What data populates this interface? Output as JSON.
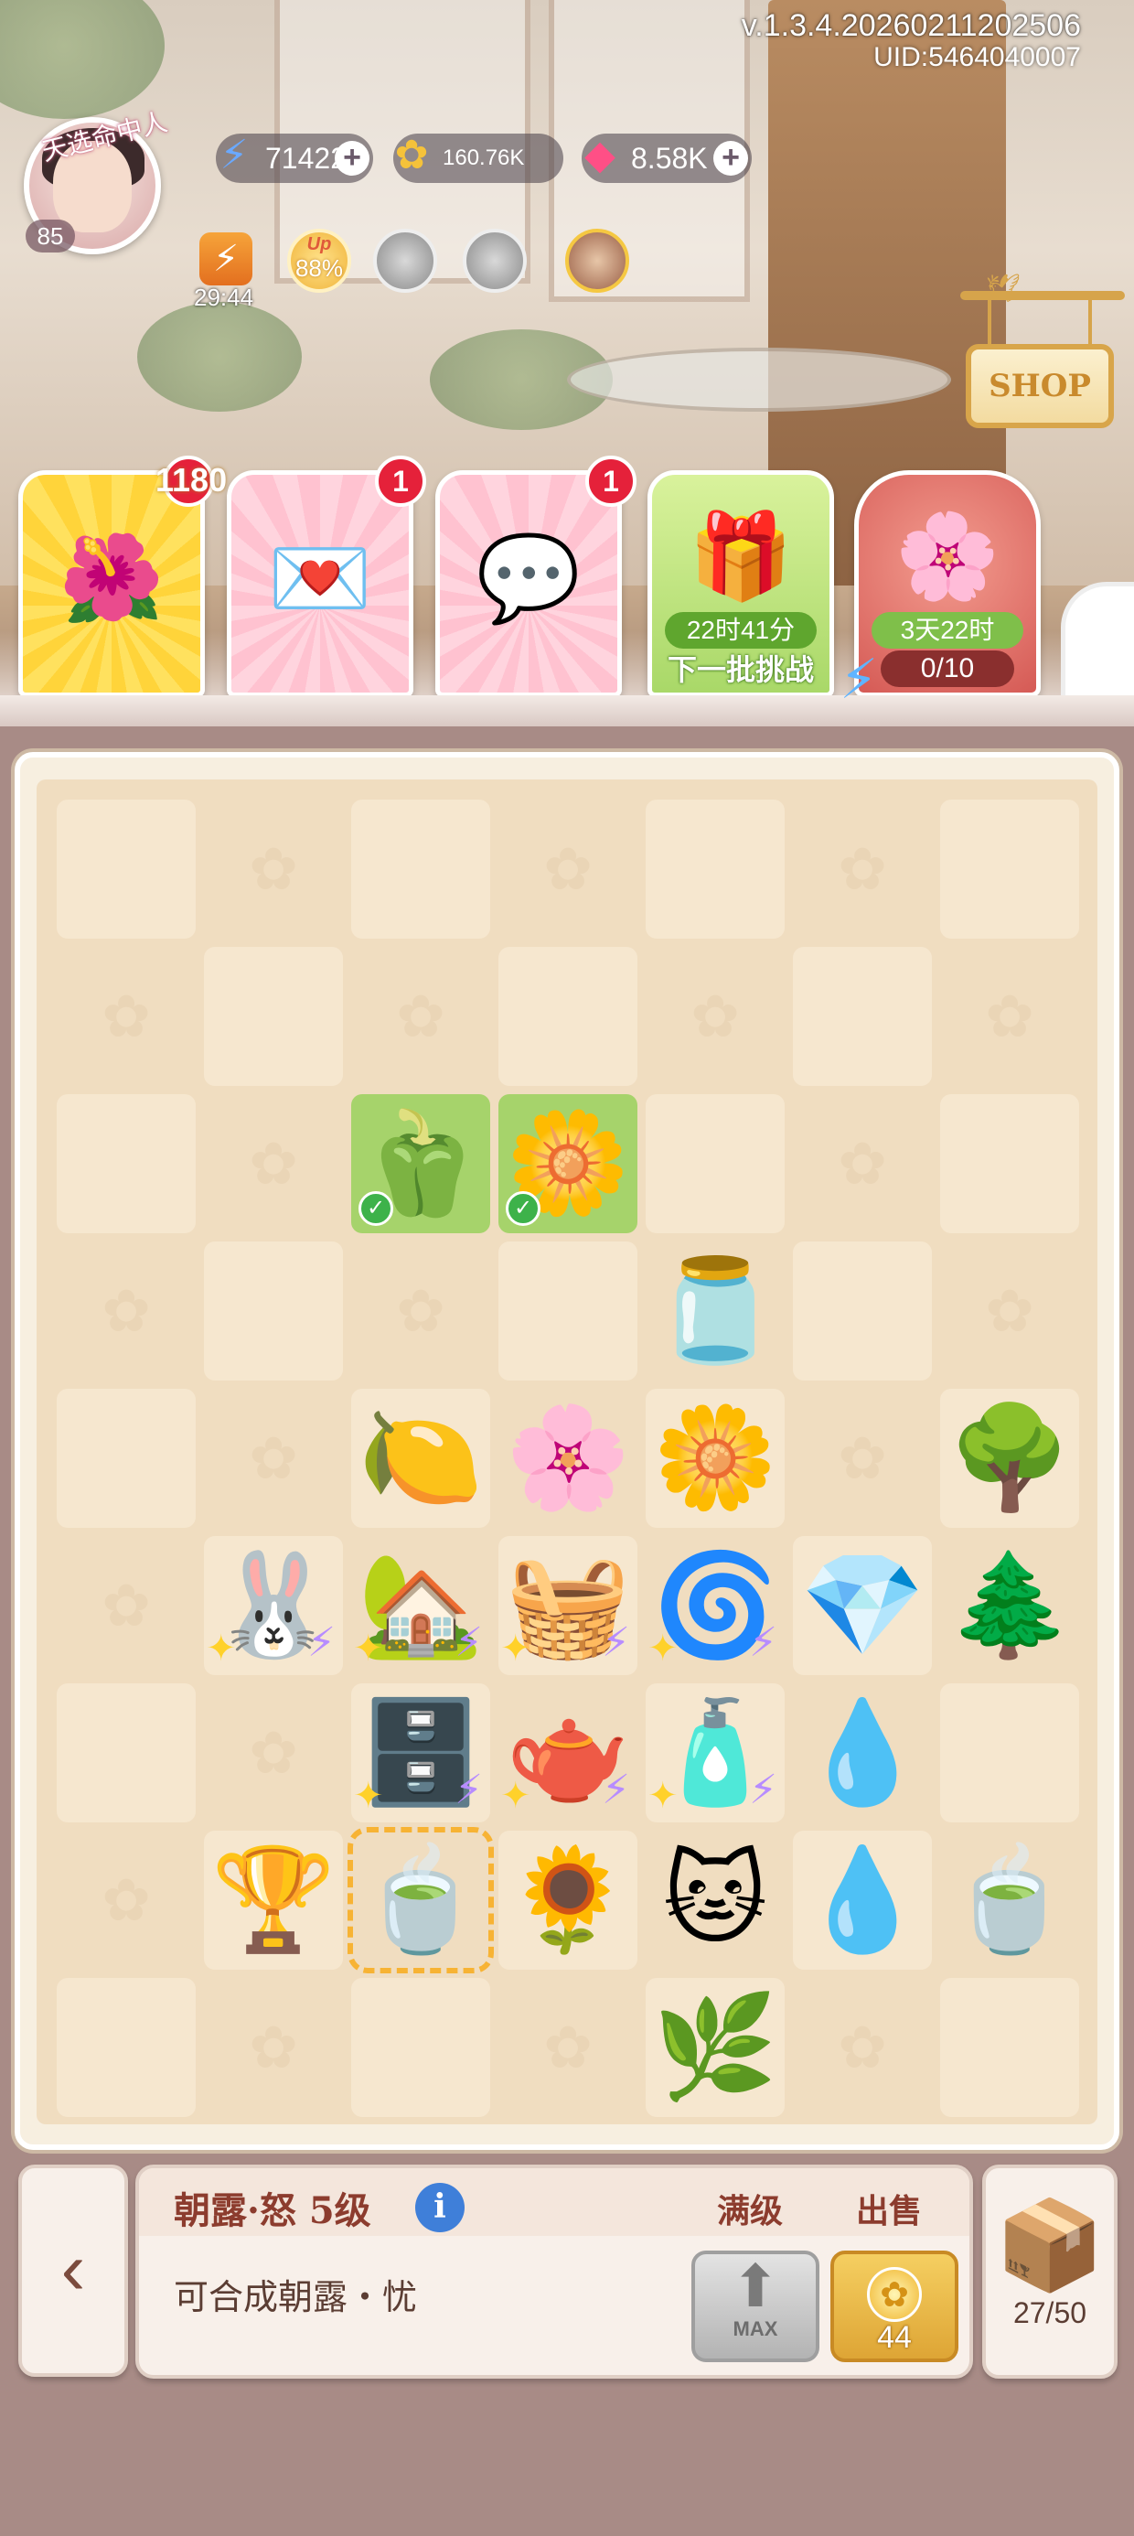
{
  "header": {
    "version": "v.1.3.4.20260211202506",
    "uid": "UID:5464040007",
    "avatar_title": "天选命中人",
    "level": "85"
  },
  "resources": [
    {
      "name": "energy",
      "icon": "lightning-icon",
      "value": "71422"
    },
    {
      "name": "coins",
      "icon": "clover-coin-icon",
      "value": "160.76K"
    },
    {
      "name": "gems",
      "icon": "gem-icon",
      "value": "8.58K"
    }
  ],
  "buffs": {
    "energy_timer": "29:44",
    "up_label": "Up",
    "up_value": "88%"
  },
  "shop": {
    "label": "SHOP"
  },
  "cards": [
    {
      "id": "card-bell-jar",
      "badge": "1180",
      "icon": "flower-bell-jar-icon"
    },
    {
      "id": "card-letter",
      "badge": "1",
      "icon": "love-letter-icon"
    },
    {
      "id": "card-chat",
      "badge": "1",
      "icon": "hashtag-chat-icon"
    },
    {
      "id": "card-gift",
      "timer": "22时41分",
      "subtitle": "下一批挑战",
      "icon": "gift-box-icon"
    },
    {
      "id": "card-event",
      "timer": "3天22时",
      "progress": "0/10",
      "icon": "peach-blossom-icon"
    }
  ],
  "board": {
    "columns": 7,
    "rows": 9,
    "items": [
      {
        "row": 2,
        "col": 2,
        "name": "pepper-creature",
        "glyph": "🫑",
        "selected": true
      },
      {
        "row": 2,
        "col": 3,
        "name": "osmanthus-branch",
        "glyph": "🌼",
        "selected": true
      },
      {
        "row": 3,
        "col": 4,
        "name": "vine-bell-jar",
        "glyph": "🫙"
      },
      {
        "row": 4,
        "col": 2,
        "name": "lemon",
        "glyph": "🍋"
      },
      {
        "row": 4,
        "col": 3,
        "name": "lily",
        "glyph": "🌸"
      },
      {
        "row": 4,
        "col": 4,
        "name": "magnolia",
        "glyph": "🌼"
      },
      {
        "row": 4,
        "col": 6,
        "name": "red-tree-bell-jar",
        "glyph": "🌳"
      },
      {
        "row": 5,
        "col": 1,
        "name": "bunny-dessert-stand",
        "glyph": "🐰",
        "sparkle": true
      },
      {
        "row": 5,
        "col": 2,
        "name": "greenhouse",
        "glyph": "🏡",
        "sparkle": true
      },
      {
        "row": 5,
        "col": 3,
        "name": "flower-cart",
        "glyph": "🧺",
        "sparkle": true
      },
      {
        "row": 5,
        "col": 4,
        "name": "galaxy-swirl",
        "glyph": "🌀",
        "sparkle": true
      },
      {
        "row": 5,
        "col": 5,
        "name": "red-crystal",
        "glyph": "💎"
      },
      {
        "row": 5,
        "col": 6,
        "name": "blue-tree-bell-jar",
        "glyph": "🌲"
      },
      {
        "row": 6,
        "col": 2,
        "name": "golden-cabinet",
        "glyph": "🗄️",
        "sparkle": true
      },
      {
        "row": 6,
        "col": 3,
        "name": "teapot",
        "glyph": "🫖",
        "sparkle": true
      },
      {
        "row": 6,
        "col": 4,
        "name": "perfume-bottle",
        "glyph": "🧴",
        "sparkle": true
      },
      {
        "row": 6,
        "col": 5,
        "name": "sad-water-drop",
        "glyph": "💧"
      },
      {
        "row": 7,
        "col": 1,
        "name": "golden-cup-tile",
        "glyph": "🏆"
      },
      {
        "row": 7,
        "col": 2,
        "name": "cat-teacup",
        "glyph": "🍵",
        "framed": true
      },
      {
        "row": 7,
        "col": 3,
        "name": "yellow-flower-frog",
        "glyph": "🌻"
      },
      {
        "row": 7,
        "col": 4,
        "name": "cat-blue-teacup",
        "glyph": "🐱"
      },
      {
        "row": 7,
        "col": 5,
        "name": "angry-green-drop",
        "glyph": "💧"
      },
      {
        "row": 7,
        "col": 6,
        "name": "cat-teacup",
        "glyph": "🍵"
      },
      {
        "row": 8,
        "col": 4,
        "name": "leaf-bell-jar",
        "glyph": "🌿"
      }
    ]
  },
  "info_panel": {
    "title": "朝露·怒 5级",
    "info_icon": "i",
    "col_max": "满级",
    "col_sell": "出售",
    "description": "可合成朝露・忧",
    "max_label": "MAX",
    "sell_price": "44"
  },
  "storage": {
    "count": "27/50"
  }
}
